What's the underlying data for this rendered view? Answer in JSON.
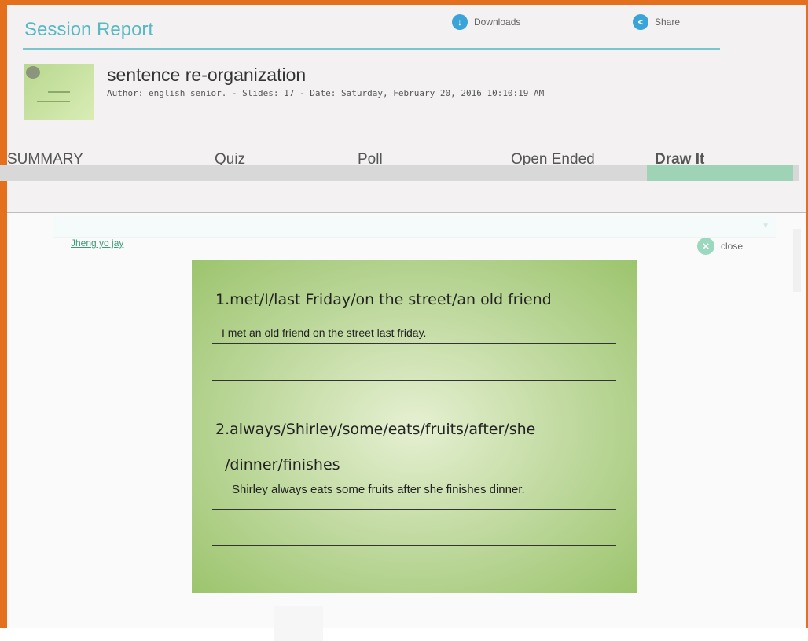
{
  "header": {
    "title": "Session Report",
    "downloads_label": "Downloads",
    "share_label": "Share"
  },
  "session": {
    "name": "sentence re-organization",
    "meta": "Author: english senior. - Slides: 17 - Date: Saturday, February 20, 2016 10:10:19 AM"
  },
  "tabs": [
    {
      "label": "SUMMARY",
      "active": false
    },
    {
      "label": "Quiz",
      "active": false
    },
    {
      "label": "Poll",
      "active": false
    },
    {
      "label": "Open Ended",
      "active": false
    },
    {
      "label": "Draw It",
      "active": true
    }
  ],
  "viewer": {
    "student_name": "Jheng yo jay",
    "close_label": "close"
  },
  "slide": {
    "q1": "1.met/I/last Friday/on the street/an old friend",
    "a1": "I met an old friend on the street last friday.",
    "q2_line1": "2.always/Shirley/some/eats/fruits/after/she",
    "q2_line2": "/dinner/finishes",
    "a2": "Shirley always eats some fruits after she finishes dinner."
  },
  "colors": {
    "frame": "#e46f1c",
    "accent": "#58b9c4",
    "tab_active": "#9ed3b5"
  },
  "icons": {
    "downloads": "download-icon",
    "share": "share-icon",
    "close": "close-icon"
  }
}
